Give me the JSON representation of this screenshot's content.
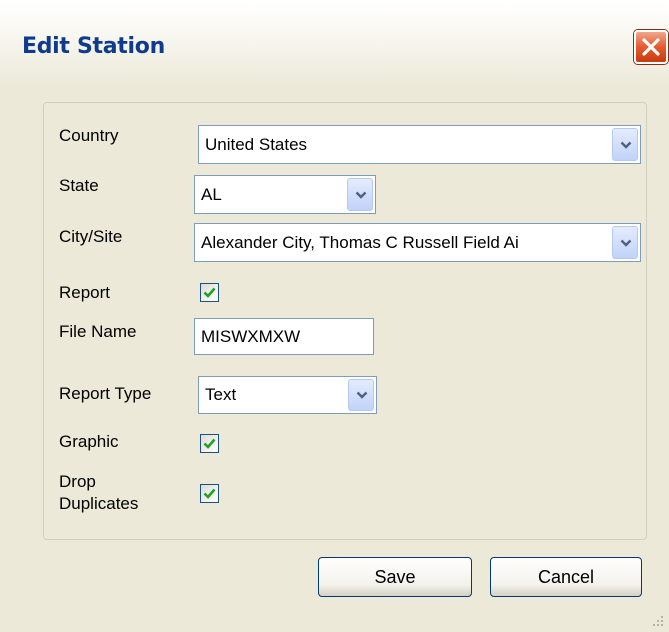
{
  "window": {
    "title": "Edit Station",
    "close_icon": "close-icon"
  },
  "form": {
    "country": {
      "label": "Country",
      "value": "United States"
    },
    "state": {
      "label": "State",
      "value": "AL"
    },
    "city": {
      "label": "City/Site",
      "value": "Alexander City, Thomas C Russell Field Ai"
    },
    "report": {
      "label": "Report",
      "checked": true
    },
    "file_name": {
      "label": "File Name",
      "value": "MISWXMXW"
    },
    "report_type": {
      "label": "Report Type",
      "value": "Text"
    },
    "graphic": {
      "label": "Graphic",
      "checked": true
    },
    "drop_duplicates": {
      "label_line1": "Drop",
      "label_line2": "Duplicates",
      "checked": true
    }
  },
  "buttons": {
    "save": "Save",
    "cancel": "Cancel"
  },
  "colors": {
    "title_text": "#103a8c",
    "dialog_bg": "#ece9d8",
    "close_button": "#e35b2e",
    "checkmark": "#21a121"
  }
}
